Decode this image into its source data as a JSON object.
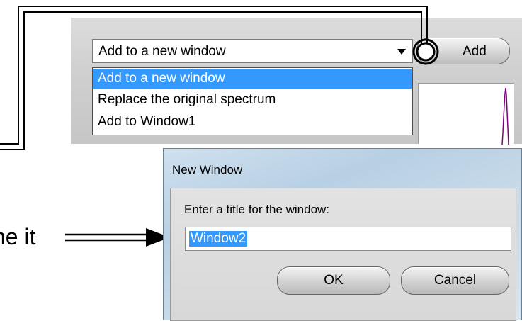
{
  "panel": {
    "combo_value": "Add to a new window",
    "add_button_label": "Add",
    "dropdown_items": [
      {
        "label": "Add to a new window",
        "selected": true
      },
      {
        "label": "Replace the original spectrum",
        "selected": false
      },
      {
        "label": "Add to Window1",
        "selected": false
      }
    ]
  },
  "dialog": {
    "title": "New Window",
    "prompt": "Enter a title for the window:",
    "input_value": "Window2",
    "ok_label": "OK",
    "cancel_label": "Cancel"
  },
  "caption": {
    "text": "ne it"
  },
  "colors": {
    "selection": "#3399ff",
    "spectrum_line": "#800080"
  },
  "icons": [
    "dropdown-arrow-icon",
    "arrow-right-icon",
    "highlight-circle-icon"
  ]
}
